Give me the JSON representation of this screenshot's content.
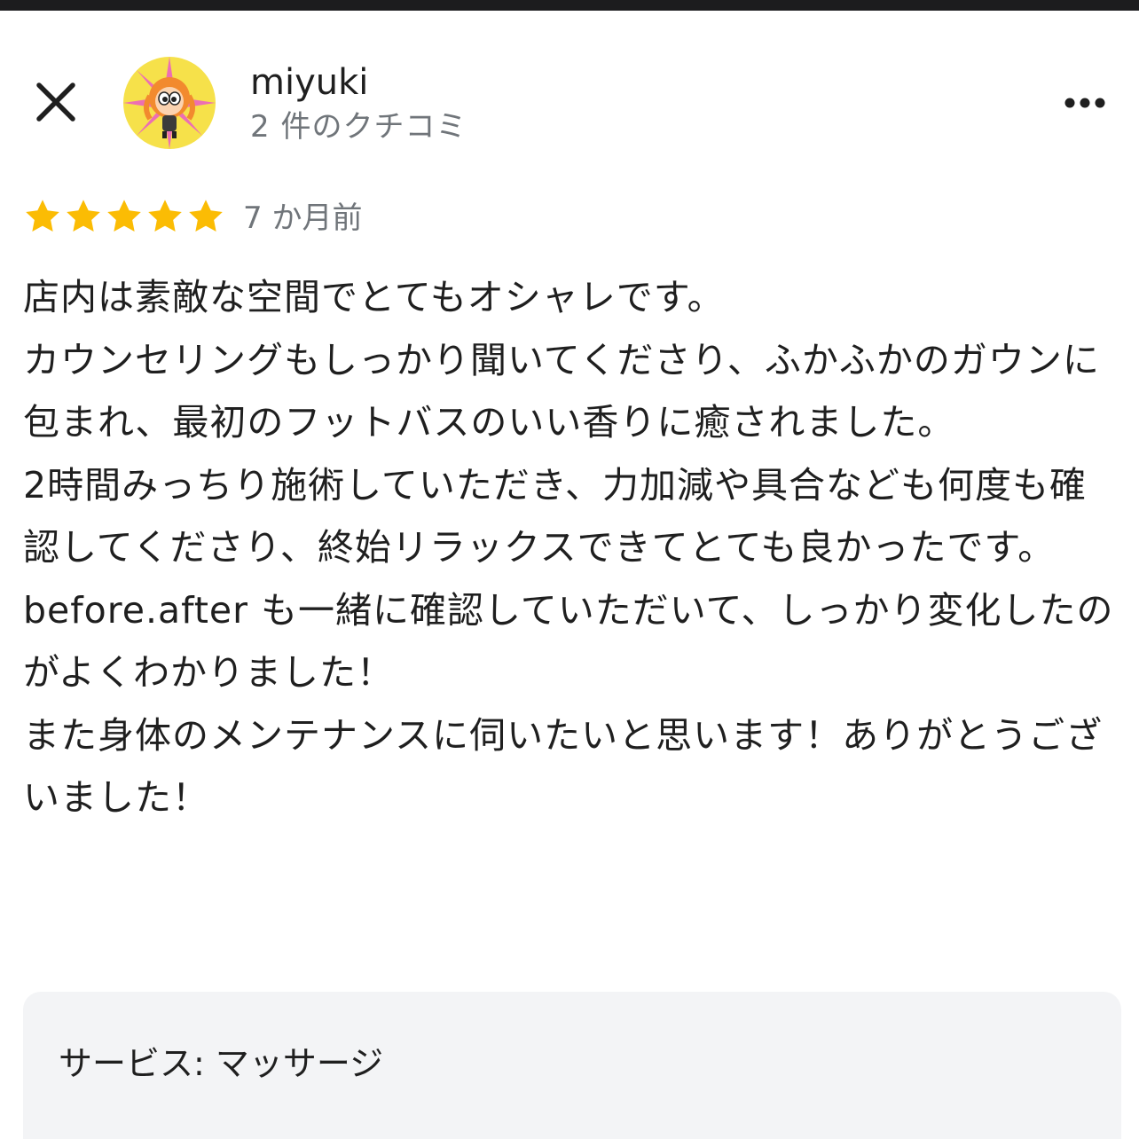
{
  "colors": {
    "star": "#FBBC04",
    "text_primary": "#1f1f1f",
    "text_secondary": "#70757a",
    "service_bg": "#f3f4f6"
  },
  "header": {
    "close_icon": "close-icon",
    "user_name": "miyuki",
    "review_count": "2 件のクチコミ",
    "more_icon": "more-horizontal-icon"
  },
  "review": {
    "rating": 5,
    "rating_max": 5,
    "time_ago": "7 か月前",
    "paragraphs": [
      "店内は素敵な空間でとてもオシャレです。",
      "カウンセリングもしっかり聞いてくださり、ふかふかのガウンに包まれ、最初のフットバスのいい香りに癒されました。",
      "2時間みっちり施術していただき、力加減や具合なども何度も確認してくださり、終始リラックスできてとても良かったです。",
      "before.after も一緒に確認していただいて、しっかり変化したのがよくわかりました！",
      "また身体のメンテナンスに伺いたいと思います！ありがとうございました！"
    ]
  },
  "service": {
    "label": "サービス: マッサージ"
  }
}
